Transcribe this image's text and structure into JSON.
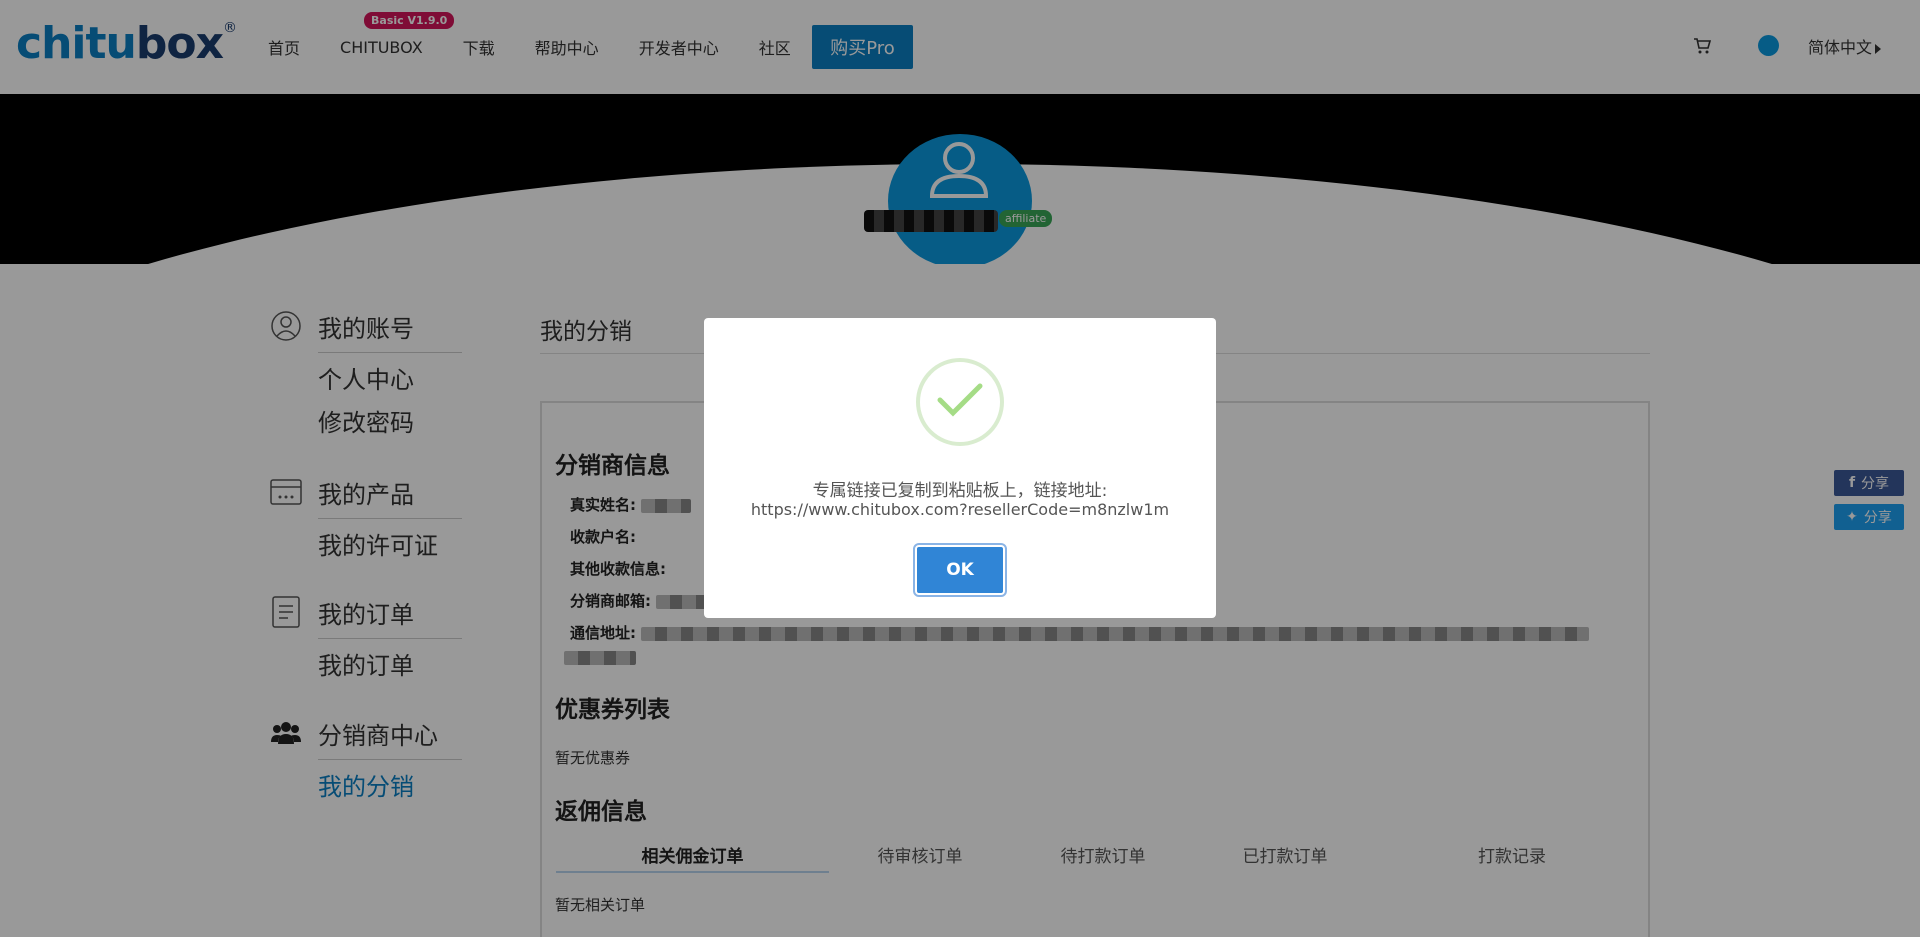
{
  "header": {
    "logo_part1": "chitu",
    "logo_part2": "box",
    "logo_mark": "®",
    "nav": [
      "首页",
      "CHITUBOX",
      "下载",
      "帮助中心",
      "开发者中心",
      "社区"
    ],
    "version_badge": "Basic V1.9.0",
    "buy_button": "购买Pro",
    "language": "简体中文",
    "cart_icon": "cart-icon",
    "accent": "#0b7fc4"
  },
  "banner": {
    "affiliate_badge": "affiliate"
  },
  "sidebar": {
    "groups": [
      {
        "title": "我的账号",
        "icon": "user-circle-icon",
        "items": [
          "个人中心",
          "修改密码"
        ]
      },
      {
        "title": "我的产品",
        "icon": "card-icon",
        "items": [
          "我的许可证"
        ]
      },
      {
        "title": "我的订单",
        "icon": "document-icon",
        "items": [
          "我的订单"
        ]
      },
      {
        "title": "分销商中心",
        "icon": "users-icon",
        "items": [
          "我的分销"
        ]
      }
    ],
    "active_item": "我的分销"
  },
  "main": {
    "title": "我的分销",
    "distributor_section": "分销商信息",
    "fields": {
      "real_name": "真实姓名:",
      "account_name": "收款户名:",
      "other_payment": "其他收款信息:",
      "email": "分销商邮箱:",
      "address": "通信地址:"
    },
    "coupon_section": "优惠券列表",
    "no_coupons": "暂无优惠券",
    "commission_section": "返佣信息",
    "tabs": [
      "相关佣金订单",
      "待审核订单",
      "待打款订单",
      "已打款订单",
      "打款记录"
    ],
    "no_orders": "暂无相关订单"
  },
  "share": {
    "facebook": "分享",
    "twitter": "分享"
  },
  "modal": {
    "message": "专属链接已复制到粘贴板上，链接地址:",
    "url": "https://www.chitubox.com?resellerCode=m8nzlw1m",
    "ok_button": "OK",
    "icon": "success-check-icon"
  }
}
